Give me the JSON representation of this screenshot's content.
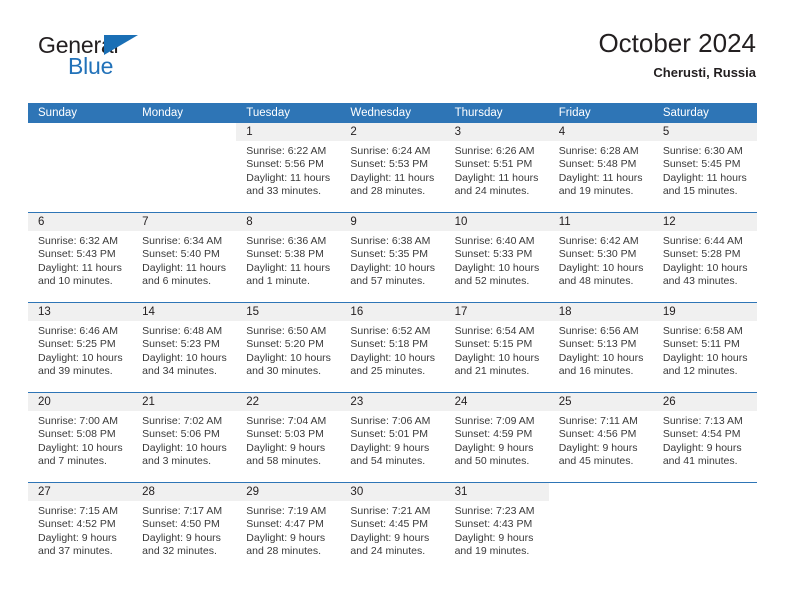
{
  "brand": {
    "word1": "General",
    "word2": "Blue",
    "triangle_color": "#1a6fb5",
    "blue_text_color": "#2272b9"
  },
  "header": {
    "title": "October 2024",
    "subtitle": "Cherusti, Russia",
    "header_bg": "#2e75b6",
    "daynum_bg": "#f0f0f0"
  },
  "weekday_headers": [
    "Sunday",
    "Monday",
    "Tuesday",
    "Wednesday",
    "Thursday",
    "Friday",
    "Saturday"
  ],
  "weeks": [
    [
      {
        "day": "",
        "sunrise": "",
        "sunset": "",
        "daylight1": "",
        "daylight2": "",
        "blank": true
      },
      {
        "day": "",
        "sunrise": "",
        "sunset": "",
        "daylight1": "",
        "daylight2": "",
        "blank": true
      },
      {
        "day": "1",
        "sunrise": "Sunrise: 6:22 AM",
        "sunset": "Sunset: 5:56 PM",
        "daylight1": "Daylight: 11 hours",
        "daylight2": "and 33 minutes."
      },
      {
        "day": "2",
        "sunrise": "Sunrise: 6:24 AM",
        "sunset": "Sunset: 5:53 PM",
        "daylight1": "Daylight: 11 hours",
        "daylight2": "and 28 minutes."
      },
      {
        "day": "3",
        "sunrise": "Sunrise: 6:26 AM",
        "sunset": "Sunset: 5:51 PM",
        "daylight1": "Daylight: 11 hours",
        "daylight2": "and 24 minutes."
      },
      {
        "day": "4",
        "sunrise": "Sunrise: 6:28 AM",
        "sunset": "Sunset: 5:48 PM",
        "daylight1": "Daylight: 11 hours",
        "daylight2": "and 19 minutes."
      },
      {
        "day": "5",
        "sunrise": "Sunrise: 6:30 AM",
        "sunset": "Sunset: 5:45 PM",
        "daylight1": "Daylight: 11 hours",
        "daylight2": "and 15 minutes."
      }
    ],
    [
      {
        "day": "6",
        "sunrise": "Sunrise: 6:32 AM",
        "sunset": "Sunset: 5:43 PM",
        "daylight1": "Daylight: 11 hours",
        "daylight2": "and 10 minutes."
      },
      {
        "day": "7",
        "sunrise": "Sunrise: 6:34 AM",
        "sunset": "Sunset: 5:40 PM",
        "daylight1": "Daylight: 11 hours",
        "daylight2": "and 6 minutes."
      },
      {
        "day": "8",
        "sunrise": "Sunrise: 6:36 AM",
        "sunset": "Sunset: 5:38 PM",
        "daylight1": "Daylight: 11 hours",
        "daylight2": "and 1 minute."
      },
      {
        "day": "9",
        "sunrise": "Sunrise: 6:38 AM",
        "sunset": "Sunset: 5:35 PM",
        "daylight1": "Daylight: 10 hours",
        "daylight2": "and 57 minutes."
      },
      {
        "day": "10",
        "sunrise": "Sunrise: 6:40 AM",
        "sunset": "Sunset: 5:33 PM",
        "daylight1": "Daylight: 10 hours",
        "daylight2": "and 52 minutes."
      },
      {
        "day": "11",
        "sunrise": "Sunrise: 6:42 AM",
        "sunset": "Sunset: 5:30 PM",
        "daylight1": "Daylight: 10 hours",
        "daylight2": "and 48 minutes."
      },
      {
        "day": "12",
        "sunrise": "Sunrise: 6:44 AM",
        "sunset": "Sunset: 5:28 PM",
        "daylight1": "Daylight: 10 hours",
        "daylight2": "and 43 minutes."
      }
    ],
    [
      {
        "day": "13",
        "sunrise": "Sunrise: 6:46 AM",
        "sunset": "Sunset: 5:25 PM",
        "daylight1": "Daylight: 10 hours",
        "daylight2": "and 39 minutes."
      },
      {
        "day": "14",
        "sunrise": "Sunrise: 6:48 AM",
        "sunset": "Sunset: 5:23 PM",
        "daylight1": "Daylight: 10 hours",
        "daylight2": "and 34 minutes."
      },
      {
        "day": "15",
        "sunrise": "Sunrise: 6:50 AM",
        "sunset": "Sunset: 5:20 PM",
        "daylight1": "Daylight: 10 hours",
        "daylight2": "and 30 minutes."
      },
      {
        "day": "16",
        "sunrise": "Sunrise: 6:52 AM",
        "sunset": "Sunset: 5:18 PM",
        "daylight1": "Daylight: 10 hours",
        "daylight2": "and 25 minutes."
      },
      {
        "day": "17",
        "sunrise": "Sunrise: 6:54 AM",
        "sunset": "Sunset: 5:15 PM",
        "daylight1": "Daylight: 10 hours",
        "daylight2": "and 21 minutes."
      },
      {
        "day": "18",
        "sunrise": "Sunrise: 6:56 AM",
        "sunset": "Sunset: 5:13 PM",
        "daylight1": "Daylight: 10 hours",
        "daylight2": "and 16 minutes."
      },
      {
        "day": "19",
        "sunrise": "Sunrise: 6:58 AM",
        "sunset": "Sunset: 5:11 PM",
        "daylight1": "Daylight: 10 hours",
        "daylight2": "and 12 minutes."
      }
    ],
    [
      {
        "day": "20",
        "sunrise": "Sunrise: 7:00 AM",
        "sunset": "Sunset: 5:08 PM",
        "daylight1": "Daylight: 10 hours",
        "daylight2": "and 7 minutes."
      },
      {
        "day": "21",
        "sunrise": "Sunrise: 7:02 AM",
        "sunset": "Sunset: 5:06 PM",
        "daylight1": "Daylight: 10 hours",
        "daylight2": "and 3 minutes."
      },
      {
        "day": "22",
        "sunrise": "Sunrise: 7:04 AM",
        "sunset": "Sunset: 5:03 PM",
        "daylight1": "Daylight: 9 hours",
        "daylight2": "and 58 minutes."
      },
      {
        "day": "23",
        "sunrise": "Sunrise: 7:06 AM",
        "sunset": "Sunset: 5:01 PM",
        "daylight1": "Daylight: 9 hours",
        "daylight2": "and 54 minutes."
      },
      {
        "day": "24",
        "sunrise": "Sunrise: 7:09 AM",
        "sunset": "Sunset: 4:59 PM",
        "daylight1": "Daylight: 9 hours",
        "daylight2": "and 50 minutes."
      },
      {
        "day": "25",
        "sunrise": "Sunrise: 7:11 AM",
        "sunset": "Sunset: 4:56 PM",
        "daylight1": "Daylight: 9 hours",
        "daylight2": "and 45 minutes."
      },
      {
        "day": "26",
        "sunrise": "Sunrise: 7:13 AM",
        "sunset": "Sunset: 4:54 PM",
        "daylight1": "Daylight: 9 hours",
        "daylight2": "and 41 minutes."
      }
    ],
    [
      {
        "day": "27",
        "sunrise": "Sunrise: 7:15 AM",
        "sunset": "Sunset: 4:52 PM",
        "daylight1": "Daylight: 9 hours",
        "daylight2": "and 37 minutes."
      },
      {
        "day": "28",
        "sunrise": "Sunrise: 7:17 AM",
        "sunset": "Sunset: 4:50 PM",
        "daylight1": "Daylight: 9 hours",
        "daylight2": "and 32 minutes."
      },
      {
        "day": "29",
        "sunrise": "Sunrise: 7:19 AM",
        "sunset": "Sunset: 4:47 PM",
        "daylight1": "Daylight: 9 hours",
        "daylight2": "and 28 minutes."
      },
      {
        "day": "30",
        "sunrise": "Sunrise: 7:21 AM",
        "sunset": "Sunset: 4:45 PM",
        "daylight1": "Daylight: 9 hours",
        "daylight2": "and 24 minutes."
      },
      {
        "day": "31",
        "sunrise": "Sunrise: 7:23 AM",
        "sunset": "Sunset: 4:43 PM",
        "daylight1": "Daylight: 9 hours",
        "daylight2": "and 19 minutes."
      },
      {
        "day": "",
        "sunrise": "",
        "sunset": "",
        "daylight1": "",
        "daylight2": "",
        "blank": true
      },
      {
        "day": "",
        "sunrise": "",
        "sunset": "",
        "daylight1": "",
        "daylight2": "",
        "blank": true
      }
    ]
  ]
}
